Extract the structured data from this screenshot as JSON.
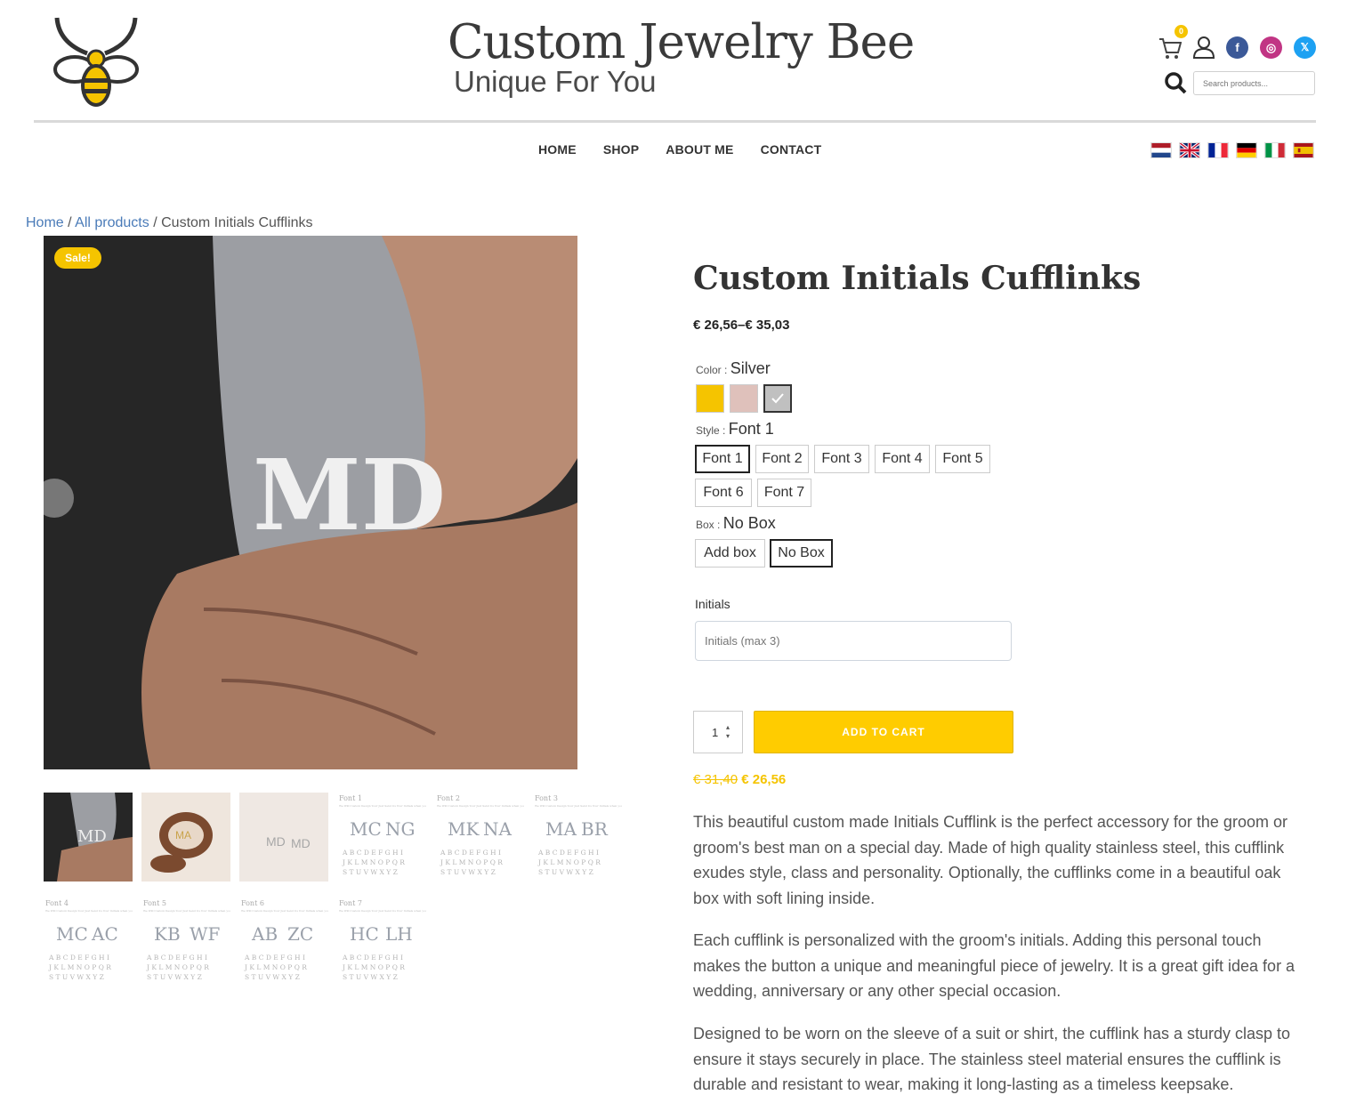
{
  "brand": {
    "title": "Custom Jewelry Bee",
    "tagline": "Unique For You"
  },
  "header": {
    "cart_count": "0",
    "social": {
      "facebook": "f",
      "instagram": "◎",
      "x": "𝕏"
    },
    "search_placeholder": "Search products..."
  },
  "nav": {
    "items": [
      "HOME",
      "SHOP",
      "ABOUT ME",
      "CONTACT"
    ]
  },
  "languages": [
    "Dutch",
    "English",
    "French",
    "German",
    "Italian",
    "Spanish"
  ],
  "breadcrumb": {
    "home": "Home",
    "all": "All products",
    "current": "Custom Initials Cufflinks",
    "sep": "/"
  },
  "gallery": {
    "sale_badge": "Sale!"
  },
  "product": {
    "title": "Custom Initials Cufflinks",
    "price_range": "€ 26,56–€ 35,03",
    "color_label": "Color",
    "color_value": "Silver",
    "colors": [
      "#f5c400",
      "#dfc1bb",
      "#c0c0c0"
    ],
    "style_label": "Style",
    "style_value": "Font 1",
    "styles": [
      "Font 1",
      "Font 2",
      "Font 3",
      "Font 4",
      "Font 5",
      "Font 6",
      "Font 7"
    ],
    "box_label": "Box",
    "box_value": "No Box",
    "boxes": [
      "Add box",
      "No Box"
    ],
    "initials_label": "Initials",
    "initials_placeholder": "Initials (max 3)",
    "quantity": "1",
    "add_to_cart": "ADD TO CART",
    "old_price": "€ 31,40",
    "sale_price": "€ 26,56"
  },
  "description": [
    "This beautiful custom made Initials Cufflink is the perfect accessory for the groom or groom's best man on a special day. Made of high quality stainless steel, this cufflink exudes style, class and personality. Optionally, the cufflinks come in a beautiful oak box with soft lining inside.",
    "Each cufflink is personalized with the groom's initials. Adding this personal touch makes the button a unique and meaningful piece of jewelry. It is a great gift idea for a wedding, anniversary or any other special occasion.",
    "Designed to be worn on the sleeve of a suit or shirt, the cufflink has a sturdy clasp to ensure it stays securely in place. The stainless steel material ensures the cufflink is durable and resistant to wear, making it long-lasting as a timeless keepsake."
  ],
  "thumbnails": {
    "font_sheet_heading": "We Will Custom Design Your Just Send Us Your Initials when you place an order.",
    "font_sheets": [
      {
        "font": "Font 1",
        "a": "MC",
        "b": "NG"
      },
      {
        "font": "Font 2",
        "a": "MK",
        "b": "NA"
      },
      {
        "font": "Font 3",
        "a": "MA",
        "b": "BR"
      },
      {
        "font": "Font 4",
        "a": "MC",
        "b": "AC"
      },
      {
        "font": "Font 5",
        "a": "KB",
        "b": "WF"
      },
      {
        "font": "Font 6",
        "a": "AB",
        "b": "ZC"
      },
      {
        "font": "Font 7",
        "a": "HC",
        "b": "LH"
      }
    ],
    "alphabet": [
      "ABCDEFGHI",
      "JKLMNOPQR",
      "STUVWXYZ"
    ]
  }
}
